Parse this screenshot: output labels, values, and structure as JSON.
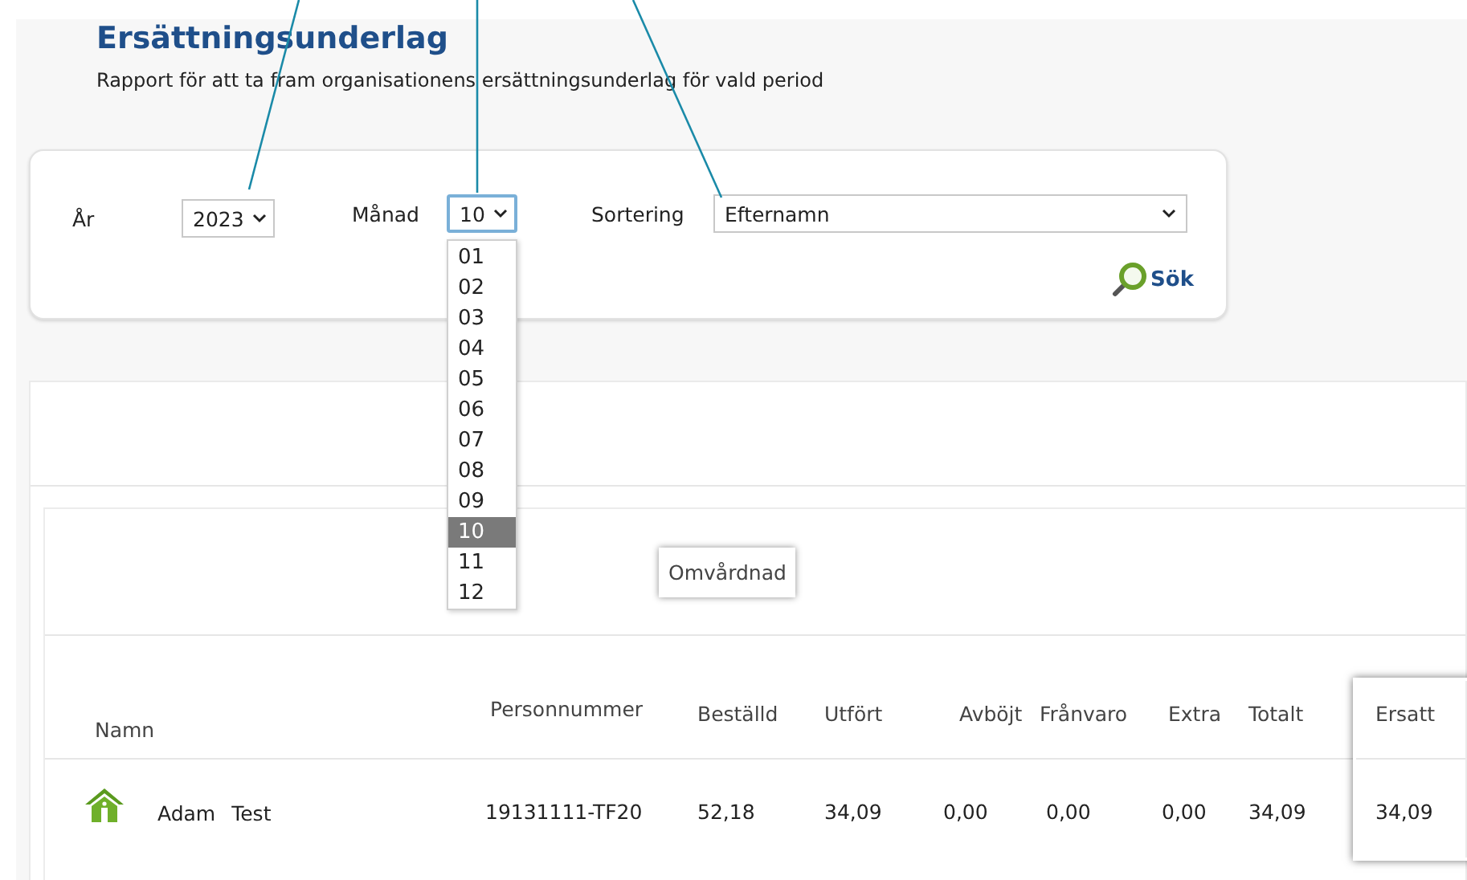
{
  "page": {
    "title": "Ersättningsunderlag",
    "description": "Rapport för att ta fram organisationens ersättningsunderlag för vald period"
  },
  "filters": [
    {
      "label": "År",
      "value": "2023",
      "focused": false
    },
    {
      "label": "Månad",
      "value": "10",
      "focused": true
    },
    {
      "label": "Sortering",
      "value": "Efternamn",
      "focused": false
    }
  ],
  "month_dropdown": {
    "options": [
      {
        "label": "01",
        "selected": false
      },
      {
        "label": "02",
        "selected": false
      },
      {
        "label": "03",
        "selected": false
      },
      {
        "label": "04",
        "selected": false
      },
      {
        "label": "05",
        "selected": false
      },
      {
        "label": "06",
        "selected": false
      },
      {
        "label": "07",
        "selected": false
      },
      {
        "label": "08",
        "selected": false
      },
      {
        "label": "09",
        "selected": false
      },
      {
        "label": "10",
        "selected": true
      },
      {
        "label": "11",
        "selected": false
      },
      {
        "label": "12",
        "selected": false
      }
    ]
  },
  "search_button": "Sök",
  "results": {
    "group_label": "Omvårdnad",
    "columns": [
      {
        "label": "Namn",
        "highlighted": false
      },
      {
        "label": "Personnummer",
        "highlighted": false
      },
      {
        "label": "Beställd",
        "highlighted": false
      },
      {
        "label": "Utfört",
        "highlighted": false
      },
      {
        "label": "Avböjt",
        "highlighted": false
      },
      {
        "label": "Frånvaro",
        "highlighted": false
      },
      {
        "label": "Extra",
        "highlighted": false
      },
      {
        "label": "Totalt",
        "highlighted": false
      },
      {
        "label": "Ersatt",
        "highlighted": true
      }
    ],
    "rows": [
      {
        "first_name": "Adam",
        "last_name": "Test",
        "values": [
          "19131111-TF20",
          "52,18",
          "34,09",
          "0,00",
          "0,00",
          "0,00",
          "34,09",
          "34,09"
        ]
      }
    ]
  }
}
